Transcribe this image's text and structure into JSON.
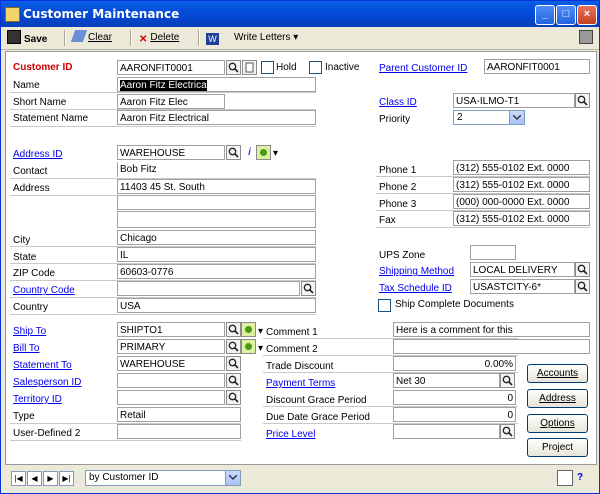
{
  "window": {
    "title": "Customer Maintenance"
  },
  "toolbar": {
    "save": "Save",
    "clear": "Clear",
    "delete": "Delete",
    "write_letters": "Write Letters"
  },
  "labels": {
    "customer_id": "Customer ID",
    "name": "Name",
    "short_name": "Short Name",
    "statement_name": "Statement Name",
    "hold": "Hold",
    "inactive": "Inactive",
    "parent_customer_id": "Parent Customer ID",
    "class_id": "Class ID",
    "priority": "Priority",
    "address_id": "Address ID",
    "contact": "Contact",
    "address": "Address",
    "city": "City",
    "state": "State",
    "zip": "ZIP Code",
    "country_code": "Country Code",
    "country": "Country",
    "phone1": "Phone 1",
    "phone2": "Phone 2",
    "phone3": "Phone 3",
    "fax": "Fax",
    "ups_zone": "UPS Zone",
    "shipping_method": "Shipping Method",
    "tax_schedule_id": "Tax Schedule ID",
    "ship_complete": "Ship Complete Documents",
    "ship_to": "Ship To",
    "bill_to": "Bill To",
    "statement_to": "Statement To",
    "salesperson_id": "Salesperson ID",
    "territory_id": "Territory ID",
    "type": "Type",
    "user_defined_2": "User-Defined 2",
    "comment1": "Comment 1",
    "comment2": "Comment 2",
    "trade_discount": "Trade Discount",
    "payment_terms": "Payment Terms",
    "discount_grace": "Discount Grace Period",
    "due_date_grace": "Due Date Grace Period",
    "price_level": "Price Level"
  },
  "values": {
    "customer_id": "AARONFIT0001",
    "name": "Aaron Fitz Electrica",
    "short_name": "Aaron Fitz Elec",
    "statement_name": "Aaron Fitz Electrical",
    "parent_customer_id": "AARONFIT0001",
    "class_id": "USA-ILMO-T1",
    "priority": "2",
    "address_id": "WAREHOUSE",
    "contact": "Bob Fitz",
    "address1": "11403 45 St. South",
    "address2": "",
    "address3": "",
    "city": "Chicago",
    "state": "IL",
    "zip": "60603-0776",
    "country_code": "",
    "country": "USA",
    "phone1": "(312) 555-0102  Ext. 0000",
    "phone2": "(312) 555-0102  Ext. 0000",
    "phone3": "(000) 000-0000  Ext. 0000",
    "fax": "(312) 555-0102  Ext. 0000",
    "ups_zone": "",
    "shipping_method": "LOCAL DELIVERY",
    "tax_schedule_id": "USASTCITY-6*",
    "ship_to": "SHIPTO1",
    "bill_to": "PRIMARY",
    "statement_to": "WAREHOUSE",
    "salesperson_id": "",
    "territory_id": "",
    "type": "Retail",
    "user_defined_2": "",
    "comment1": "Here is a comment for this",
    "comment2": "",
    "trade_discount": "0.00%",
    "payment_terms": "Net 30",
    "discount_grace": "0",
    "due_date_grace": "0",
    "price_level": ""
  },
  "buttons": {
    "accounts": "Accounts",
    "address": "Address",
    "options": "Options",
    "project": "Project"
  },
  "status": {
    "sort": "by Customer ID"
  }
}
